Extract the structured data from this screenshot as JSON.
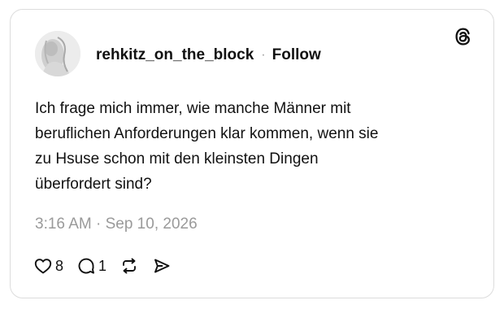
{
  "post": {
    "author": {
      "username": "rehkitz_on_the_block",
      "separator": "·",
      "follow_label": "Follow"
    },
    "text_lines": [
      "Ich frage mich immer, wie manche Männer mit",
      "beruflichen Anforderungen klar kommen, wenn sie",
      "zu Hsuse schon mit den kleinsten Dingen",
      "überfordert sind?"
    ],
    "timestamp": "3:16 AM · Sep 10, 2026",
    "actions": {
      "like_count": "8",
      "reply_count": "1"
    }
  },
  "icons": {
    "brand": "threads-logo-icon",
    "like": "heart-icon",
    "reply": "speech-bubble-icon",
    "repost": "repost-icon",
    "share": "send-icon"
  },
  "colors": {
    "text": "#111111",
    "muted": "#9a9a9a",
    "border": "#dcdcdc",
    "background": "#ffffff"
  }
}
